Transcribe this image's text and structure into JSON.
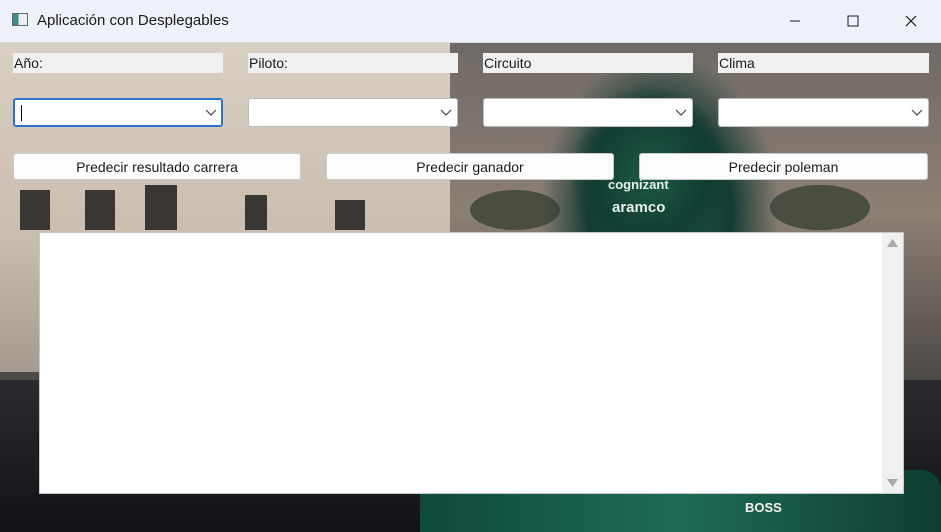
{
  "window": {
    "title": "Aplicación con Desplegables"
  },
  "labels": {
    "year": "Año:",
    "driver": "Piloto:",
    "circuit": "Circuito",
    "weather": "Clima"
  },
  "combos": {
    "year_value": "",
    "driver_value": "",
    "circuit_value": "",
    "weather_value": ""
  },
  "buttons": {
    "predict_race": "Predecir resultado carrera",
    "predict_winner": "Predecir ganador",
    "predict_pole": "Predecir poleman"
  },
  "output": {
    "text": ""
  },
  "background_text": {
    "sponsor1": "cognizant",
    "sponsor2": "aramco",
    "sponsor3": "BOSS"
  }
}
